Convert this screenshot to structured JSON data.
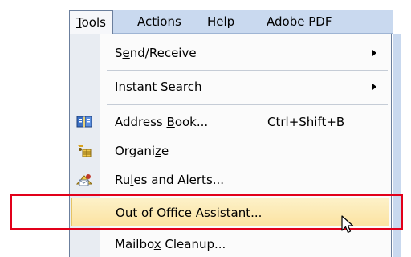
{
  "menubar": {
    "titles": [
      {
        "text_pre": "",
        "text_u": "T",
        "text_post": "ools",
        "active": true
      },
      {
        "text_pre": "",
        "text_u": "A",
        "text_post": "ctions"
      },
      {
        "text_pre": "",
        "text_u": "H",
        "text_post": "elp"
      },
      {
        "text_pre": "Adobe ",
        "text_u": "P",
        "text_post": "DF"
      }
    ]
  },
  "menu": {
    "items": [
      {
        "pre": "S",
        "u": "e",
        "post": "nd/Receive",
        "submenu": true,
        "icon": ""
      },
      {
        "pre": "",
        "u": "I",
        "post": "nstant Search",
        "submenu": true,
        "icon": ""
      },
      {
        "pre": "Address ",
        "u": "B",
        "post": "ook...",
        "shortcut": "Ctrl+Shift+B",
        "icon": "address-book-icon"
      },
      {
        "pre": "Organi",
        "u": "z",
        "post": "e",
        "icon": "organize-icon"
      },
      {
        "pre": "Ru",
        "u": "l",
        "post": "es and Alerts...",
        "icon": "rules-alerts-icon"
      },
      {
        "pre": "O",
        "u": "u",
        "post": "t of Office Assistant...",
        "highlighted": true,
        "icon": ""
      },
      {
        "pre": "Mailbo",
        "u": "x",
        "post": " Cleanup...",
        "icon": ""
      }
    ]
  }
}
